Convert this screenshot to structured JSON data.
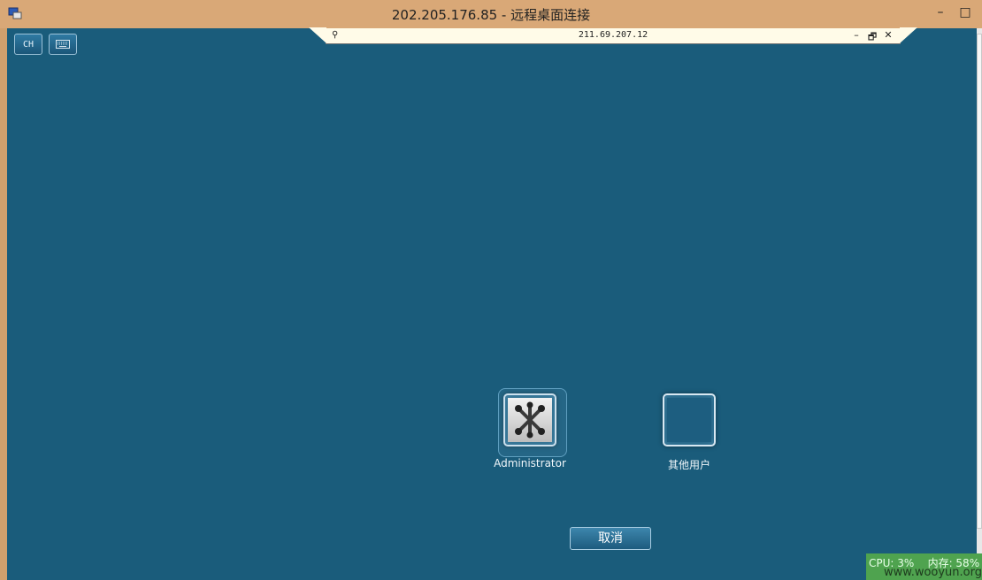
{
  "window": {
    "title": "202.205.176.85 - 远程桌面连接",
    "minimize_icon": "minimize-icon",
    "maximize_icon": "maximize-icon",
    "close_icon": "close-icon"
  },
  "toolbar": {
    "lang_label": "CH",
    "keyboard_icon": "keyboard-icon"
  },
  "connection_bar": {
    "host": "211.69.207.12",
    "pin_icon": "pin-icon",
    "minimize_glyph": "–",
    "restore_glyph": "🗗",
    "close_glyph": "✕"
  },
  "users": [
    {
      "name": "Administrator",
      "avatar": "user-avatar-icon",
      "selected": true
    },
    {
      "name": "其他用户",
      "avatar": "blank-user-icon",
      "selected": false
    }
  ],
  "cancel_label": "取消",
  "status": {
    "cpu": "CPU: 3%",
    "memory": "内存: 58%",
    "watermark": "www.wooyun.org"
  },
  "colors": {
    "desktop_bg": "#1a5c7b",
    "frame": "#d9a877",
    "status_bg": "#4fa34f"
  }
}
